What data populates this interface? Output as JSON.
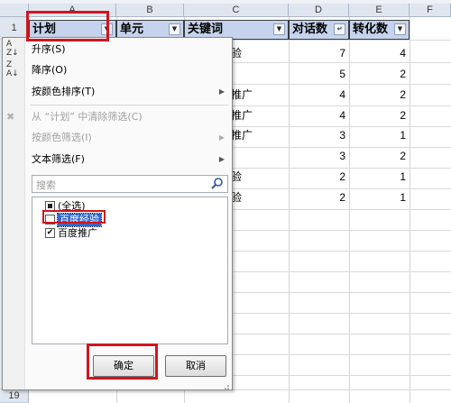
{
  "columns": [
    "A",
    "B",
    "C",
    "D",
    "E",
    "F"
  ],
  "row_numbers": [
    "1",
    "19"
  ],
  "header_cells": [
    "计划",
    "单元",
    "关键词",
    "对话数",
    "转化数"
  ],
  "data_rows": [
    {
      "d": "7",
      "e": "4"
    },
    {
      "d": "5",
      "e": "2"
    },
    {
      "d": "4",
      "e": "2"
    },
    {
      "d": "4",
      "e": "2"
    },
    {
      "d": "3",
      "e": "1"
    },
    {
      "d": "3",
      "e": "2"
    },
    {
      "d": "2",
      "e": "1"
    },
    {
      "d": "2",
      "e": "1"
    }
  ],
  "partial_c_text": [
    "验",
    "推广",
    "推广",
    "推广",
    "验",
    "验"
  ],
  "filter_menu": {
    "sort_asc": "升序(S)",
    "sort_desc": "降序(O)",
    "sort_by_color": "按颜色排序(T)",
    "clear_filter": "从 “计划” 中清除筛选(C)",
    "filter_by_color": "按颜色筛选(I)",
    "text_filter": "文本筛选(F)",
    "search_placeholder": "搜索",
    "items": [
      {
        "label": "(全选)",
        "state": "partial"
      },
      {
        "label": "百度经验",
        "state": "unchecked"
      },
      {
        "label": "百度推广",
        "state": "checked"
      }
    ],
    "ok_label": "确定",
    "cancel_label": "取消"
  },
  "colors": {
    "highlight": "#d0161e",
    "header_fill": "#c5d3ec",
    "selected_item": "#3366cc"
  }
}
